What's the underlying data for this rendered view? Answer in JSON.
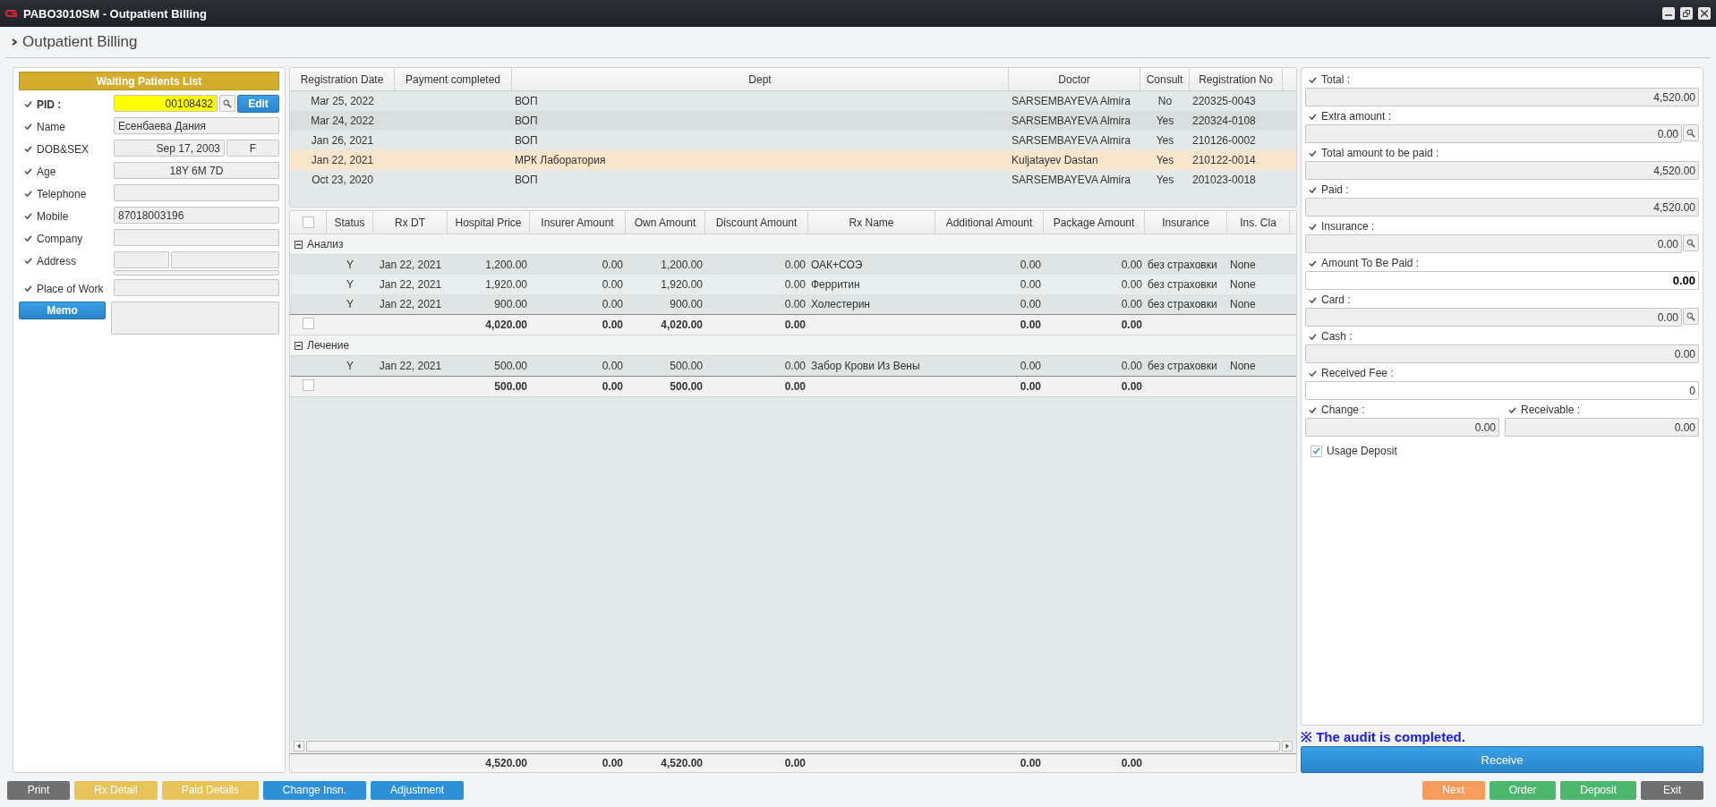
{
  "window": {
    "title": "PABO3010SM - Outpatient Billing"
  },
  "page_title": "Outpatient Billing",
  "patient": {
    "list_button": "Waiting Patients List",
    "edit_button": "Edit",
    "memo_button": "Memo",
    "fields": [
      {
        "kind": "pid",
        "label": "PID :",
        "value": "00108432"
      },
      {
        "kind": "text",
        "label": "Name",
        "value": "Есенбаева  Дания"
      },
      {
        "kind": "date-sex",
        "label": "DOB&SEX",
        "value": "Sep 17, 2003",
        "value_2": "F"
      },
      {
        "kind": "centered",
        "label": "Age",
        "value": "18Y 6M 7D"
      },
      {
        "kind": "text",
        "label": "Telephone"
      },
      {
        "kind": "text",
        "label": "Mobile",
        "value": "87018003196"
      },
      {
        "kind": "text",
        "label": "Company"
      },
      {
        "kind": "address",
        "label": "Address"
      },
      {
        "kind": "text",
        "label": "Place of Work"
      },
      {
        "kind": "memo"
      }
    ]
  },
  "visits": {
    "columns": [
      "Registration Date",
      "Payment completed",
      "Dept",
      "Doctor",
      "Consult",
      "Registration No"
    ],
    "rows": [
      {
        "registration_date": "Mar 25, 2022",
        "dept": "ВОП",
        "doctor": "SARSEMBAYEVA Almira",
        "consult": "No",
        "registration_no": "220325-0043",
        "selected": false
      },
      {
        "registration_date": "Mar 24, 2022",
        "dept": "ВОП",
        "doctor": "SARSEMBAYEVA Almira",
        "consult": "Yes",
        "registration_no": "220324-0108",
        "selected": false
      },
      {
        "registration_date": "Jan 26, 2021",
        "dept": "ВОП",
        "doctor": "SARSEMBAYEVA Almira",
        "consult": "Yes",
        "registration_no": "210126-0002",
        "selected": false
      },
      {
        "registration_date": "Jan 22, 2021",
        "dept": "МРК Лаборатория",
        "doctor": "Kuljatayev Dastan",
        "consult": "Yes",
        "registration_no": "210122-0014",
        "selected": true
      },
      {
        "registration_date": "Oct 23, 2020",
        "dept": "ВОП",
        "doctor": "SARSEMBAYEVA Almira",
        "consult": "Yes",
        "registration_no": "201023-0018",
        "selected": false
      }
    ]
  },
  "orders": {
    "select_all": {
      "checked": false
    },
    "columns": [
      "Status",
      "Rx DT",
      "Hospital Price",
      "Insurer Amount",
      "Own Amount",
      "Discount Amount",
      "Rx Name",
      "Additional Amount",
      "Package Amount",
      "Insurance",
      "Ins. Cla"
    ],
    "groups": [
      {
        "name": "Анализ",
        "expanded": true,
        "rows": [
          {
            "status": "Y",
            "rx_dt": "Jan 22, 2021",
            "hospital_price": "1,200.00",
            "insurer_amount": "0.00",
            "own_amount": "1,200.00",
            "discount_amount": "0.00",
            "rx_name": "ОАК+СОЭ",
            "additional_amount": "0.00",
            "package_amount": "0.00",
            "insurance": "без страховки",
            "ins_class": "None"
          },
          {
            "status": "Y",
            "rx_dt": "Jan 22, 2021",
            "hospital_price": "1,920.00",
            "insurer_amount": "0.00",
            "own_amount": "1,920.00",
            "discount_amount": "0.00",
            "rx_name": "Ферритин",
            "additional_amount": "0.00",
            "package_amount": "0.00",
            "insurance": "без страховки",
            "ins_class": "None"
          },
          {
            "status": "Y",
            "rx_dt": "Jan 22, 2021",
            "hospital_price": "900.00",
            "insurer_amount": "0.00",
            "own_amount": "900.00",
            "discount_amount": "0.00",
            "rx_name": "Холестерин",
            "additional_amount": "0.00",
            "package_amount": "0.00",
            "insurance": "без страховки",
            "ins_class": "None"
          }
        ],
        "subtotal": {
          "checked": false,
          "hospital_price": "4,020.00",
          "insurer_amount": "0.00",
          "own_amount": "4,020.00",
          "discount_amount": "0.00",
          "additional_amount": "0.00",
          "package_amount": "0.00"
        }
      },
      {
        "name": "Лечение",
        "expanded": true,
        "rows": [
          {
            "status": "Y",
            "rx_dt": "Jan 22, 2021",
            "hospital_price": "500.00",
            "insurer_amount": "0.00",
            "own_amount": "500.00",
            "discount_amount": "0.00",
            "rx_name": "Забор Крови Из Вены",
            "additional_amount": "0.00",
            "package_amount": "0.00",
            "insurance": "без страховки",
            "ins_class": "None"
          }
        ],
        "subtotal": {
          "checked": false,
          "hospital_price": "500.00",
          "insurer_amount": "0.00",
          "own_amount": "500.00",
          "discount_amount": "0.00",
          "additional_amount": "0.00",
          "package_amount": "0.00"
        }
      }
    ],
    "total": {
      "hospital_price": "4,520.00",
      "insurer_amount": "0.00",
      "own_amount": "4,520.00",
      "discount_amount": "0.00",
      "additional_amount": "0.00",
      "package_amount": "0.00"
    }
  },
  "payment": {
    "fields": [
      {
        "label": "Total :",
        "value": "4,520.00",
        "lookup": false,
        "editable": false,
        "highlighted": false
      },
      {
        "label": "Extra amount :",
        "value": "0.00",
        "lookup": true,
        "editable": false,
        "highlighted": false
      },
      {
        "label": "Total amount to be paid :",
        "value": "4,520.00",
        "lookup": false,
        "editable": false,
        "highlighted": false
      },
      {
        "label": "Paid :",
        "value": "4,520.00",
        "lookup": false,
        "editable": false,
        "highlighted": false
      },
      {
        "label": "Insurance :",
        "value": "0.00",
        "lookup": true,
        "editable": false,
        "highlighted": false
      },
      {
        "label": "Amount To Be Paid :",
        "value": "0.00",
        "lookup": false,
        "editable": true,
        "highlighted": true
      },
      {
        "label": "Card :",
        "value": "0.00",
        "lookup": true,
        "editable": false,
        "highlighted": false
      },
      {
        "label": "Cash :",
        "value": "0.00",
        "lookup": false,
        "editable": false,
        "highlighted": false
      },
      {
        "label": "Received Fee :",
        "value": "0",
        "lookup": false,
        "editable": true,
        "highlighted": false
      }
    ],
    "pair": [
      {
        "label": "Change :",
        "value": "0.00"
      },
      {
        "label": "Receivable :",
        "value": "0.00"
      }
    ],
    "usage_deposit": {
      "label": "Usage Deposit",
      "checked": true
    },
    "notice": "※ The audit is completed.",
    "receive_button": "Receive"
  },
  "footer": {
    "left": [
      {
        "label": "Print",
        "color": "#707070"
      },
      {
        "label": "Rx Detail",
        "color": "#e8c35a"
      },
      {
        "label": "Paid Details",
        "color": "#e8c35a"
      },
      {
        "label": "Change Insn.",
        "color": "#2e90d6"
      },
      {
        "label": "Adjustment",
        "color": "#2e90d6"
      }
    ],
    "right": [
      {
        "label": "Next",
        "color": "#f89c5c"
      },
      {
        "label": "Order",
        "color": "#4cb86c"
      },
      {
        "label": "Deposit",
        "color": "#4cb86c"
      },
      {
        "label": "Exit",
        "color": "#707070"
      }
    ]
  }
}
